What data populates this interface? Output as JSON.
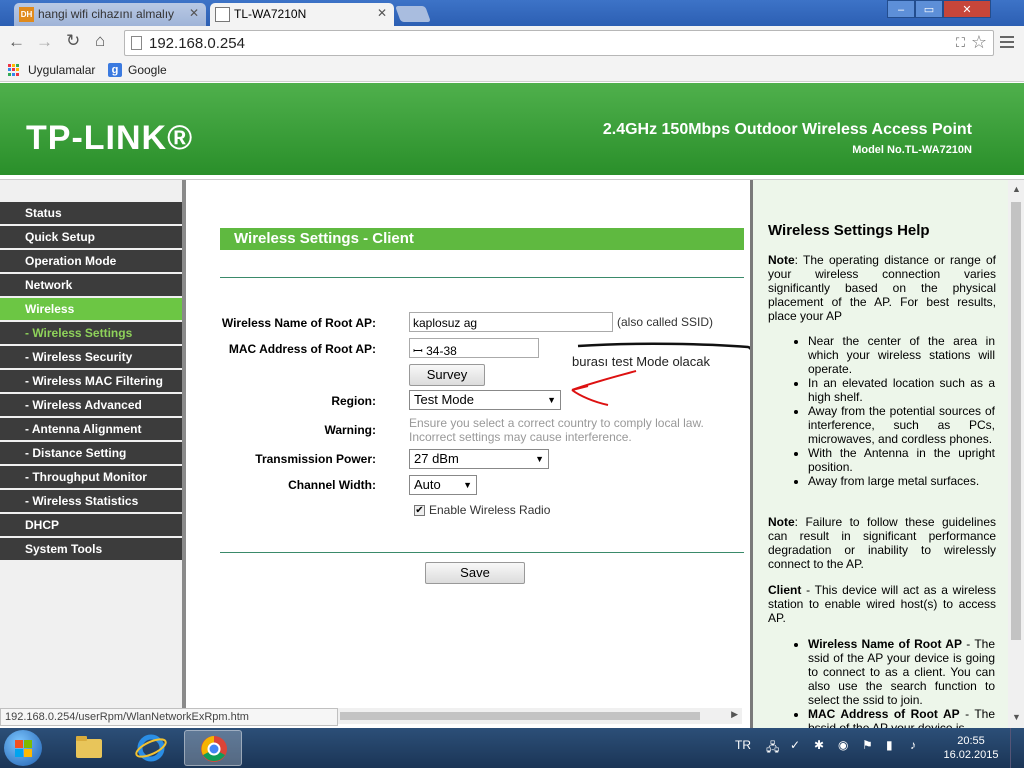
{
  "browser": {
    "tabs": [
      {
        "label": "hangi wifi cihazını almalıy",
        "favicon": "DH"
      },
      {
        "label": "TL-WA7210N",
        "favicon": ""
      }
    ],
    "url": "192.168.0.254",
    "window_controls": {
      "min": "–",
      "max": "▭",
      "close": "✕"
    },
    "bookmarks": [
      {
        "label": "Uygulamalar"
      },
      {
        "label": "Google"
      }
    ],
    "status_url": "192.168.0.254/userRpm/WlanNetworkExRpm.htm"
  },
  "header": {
    "logo": "TP-LINK®",
    "product": "2.4GHz 150Mbps Outdoor Wireless Access Point",
    "model": "Model No.TL-WA7210N",
    "color": "#3a9f38"
  },
  "nav": [
    {
      "label": "Status"
    },
    {
      "label": "Quick Setup"
    },
    {
      "label": "Operation Mode"
    },
    {
      "label": "Network"
    },
    {
      "label": "Wireless"
    },
    {
      "label": "- Wireless Settings"
    },
    {
      "label": "- Wireless Security"
    },
    {
      "label": "- Wireless MAC Filtering"
    },
    {
      "label": "- Wireless Advanced"
    },
    {
      "label": "- Antenna Alignment"
    },
    {
      "label": "- Distance Setting"
    },
    {
      "label": "- Throughput Monitor"
    },
    {
      "label": "- Wireless Statistics"
    },
    {
      "label": "DHCP"
    },
    {
      "label": "System Tools"
    }
  ],
  "form": {
    "section_title": "Wireless Settings - Client",
    "ssid_label": "Wireless Name of Root AP:",
    "ssid_value": "kaplosuz ag",
    "ssid_hint": "(also called SSID)",
    "mac_label": "MAC Address of Root AP:",
    "mac_value": "ꟷ                 34-38",
    "survey_label": "Survey",
    "region_label": "Region:",
    "region_value": "Test Mode",
    "warning_label": "Warning:",
    "warning_line1": "Ensure you select a correct country to comply local law.",
    "warning_line2": "Incorrect settings may cause interference.",
    "power_label": "Transmission Power:",
    "power_value": "27 dBm",
    "width_label": "Channel Width:",
    "width_value": "Auto",
    "radio_label": "Enable Wireless Radio",
    "radio_checked": "✔",
    "save_label": "Save",
    "annotation": "burası test Mode olacak"
  },
  "help": {
    "title": "Wireless Settings Help",
    "note1_label": "Note",
    "note1_text": ": The operating distance or range of your wireless connection varies significantly based on the physical placement of the AP. For best results, place your AP",
    "tips": [
      "Near the center of the area in which your wireless stations will operate.",
      "In an elevated location such as a high shelf.",
      "Away from the potential sources of interference, such as PCs, microwaves, and cordless phones.",
      "With the Antenna in the upright position.",
      "Away from large metal surfaces."
    ],
    "note2_label": "Note",
    "note2_text": ": Failure to follow these guidelines can result in significant performance degradation or inability to wirelessly connect to the AP.",
    "client_label": "Client",
    "client_text": " - This device will act as a wireless station to enable wired host(s) to access AP.",
    "param1_label": "Wireless Name of Root AP",
    "param1_text": " - The ssid of the AP your device is going to connect to as a client. You can also use the search function to select the ssid to join.",
    "param2_label": "MAC Address of Root AP",
    "param2_text": " - The bssid of the AP your device is"
  },
  "taskbar": {
    "lang": "TR",
    "time": "20:55",
    "date": "16.02.2015"
  }
}
